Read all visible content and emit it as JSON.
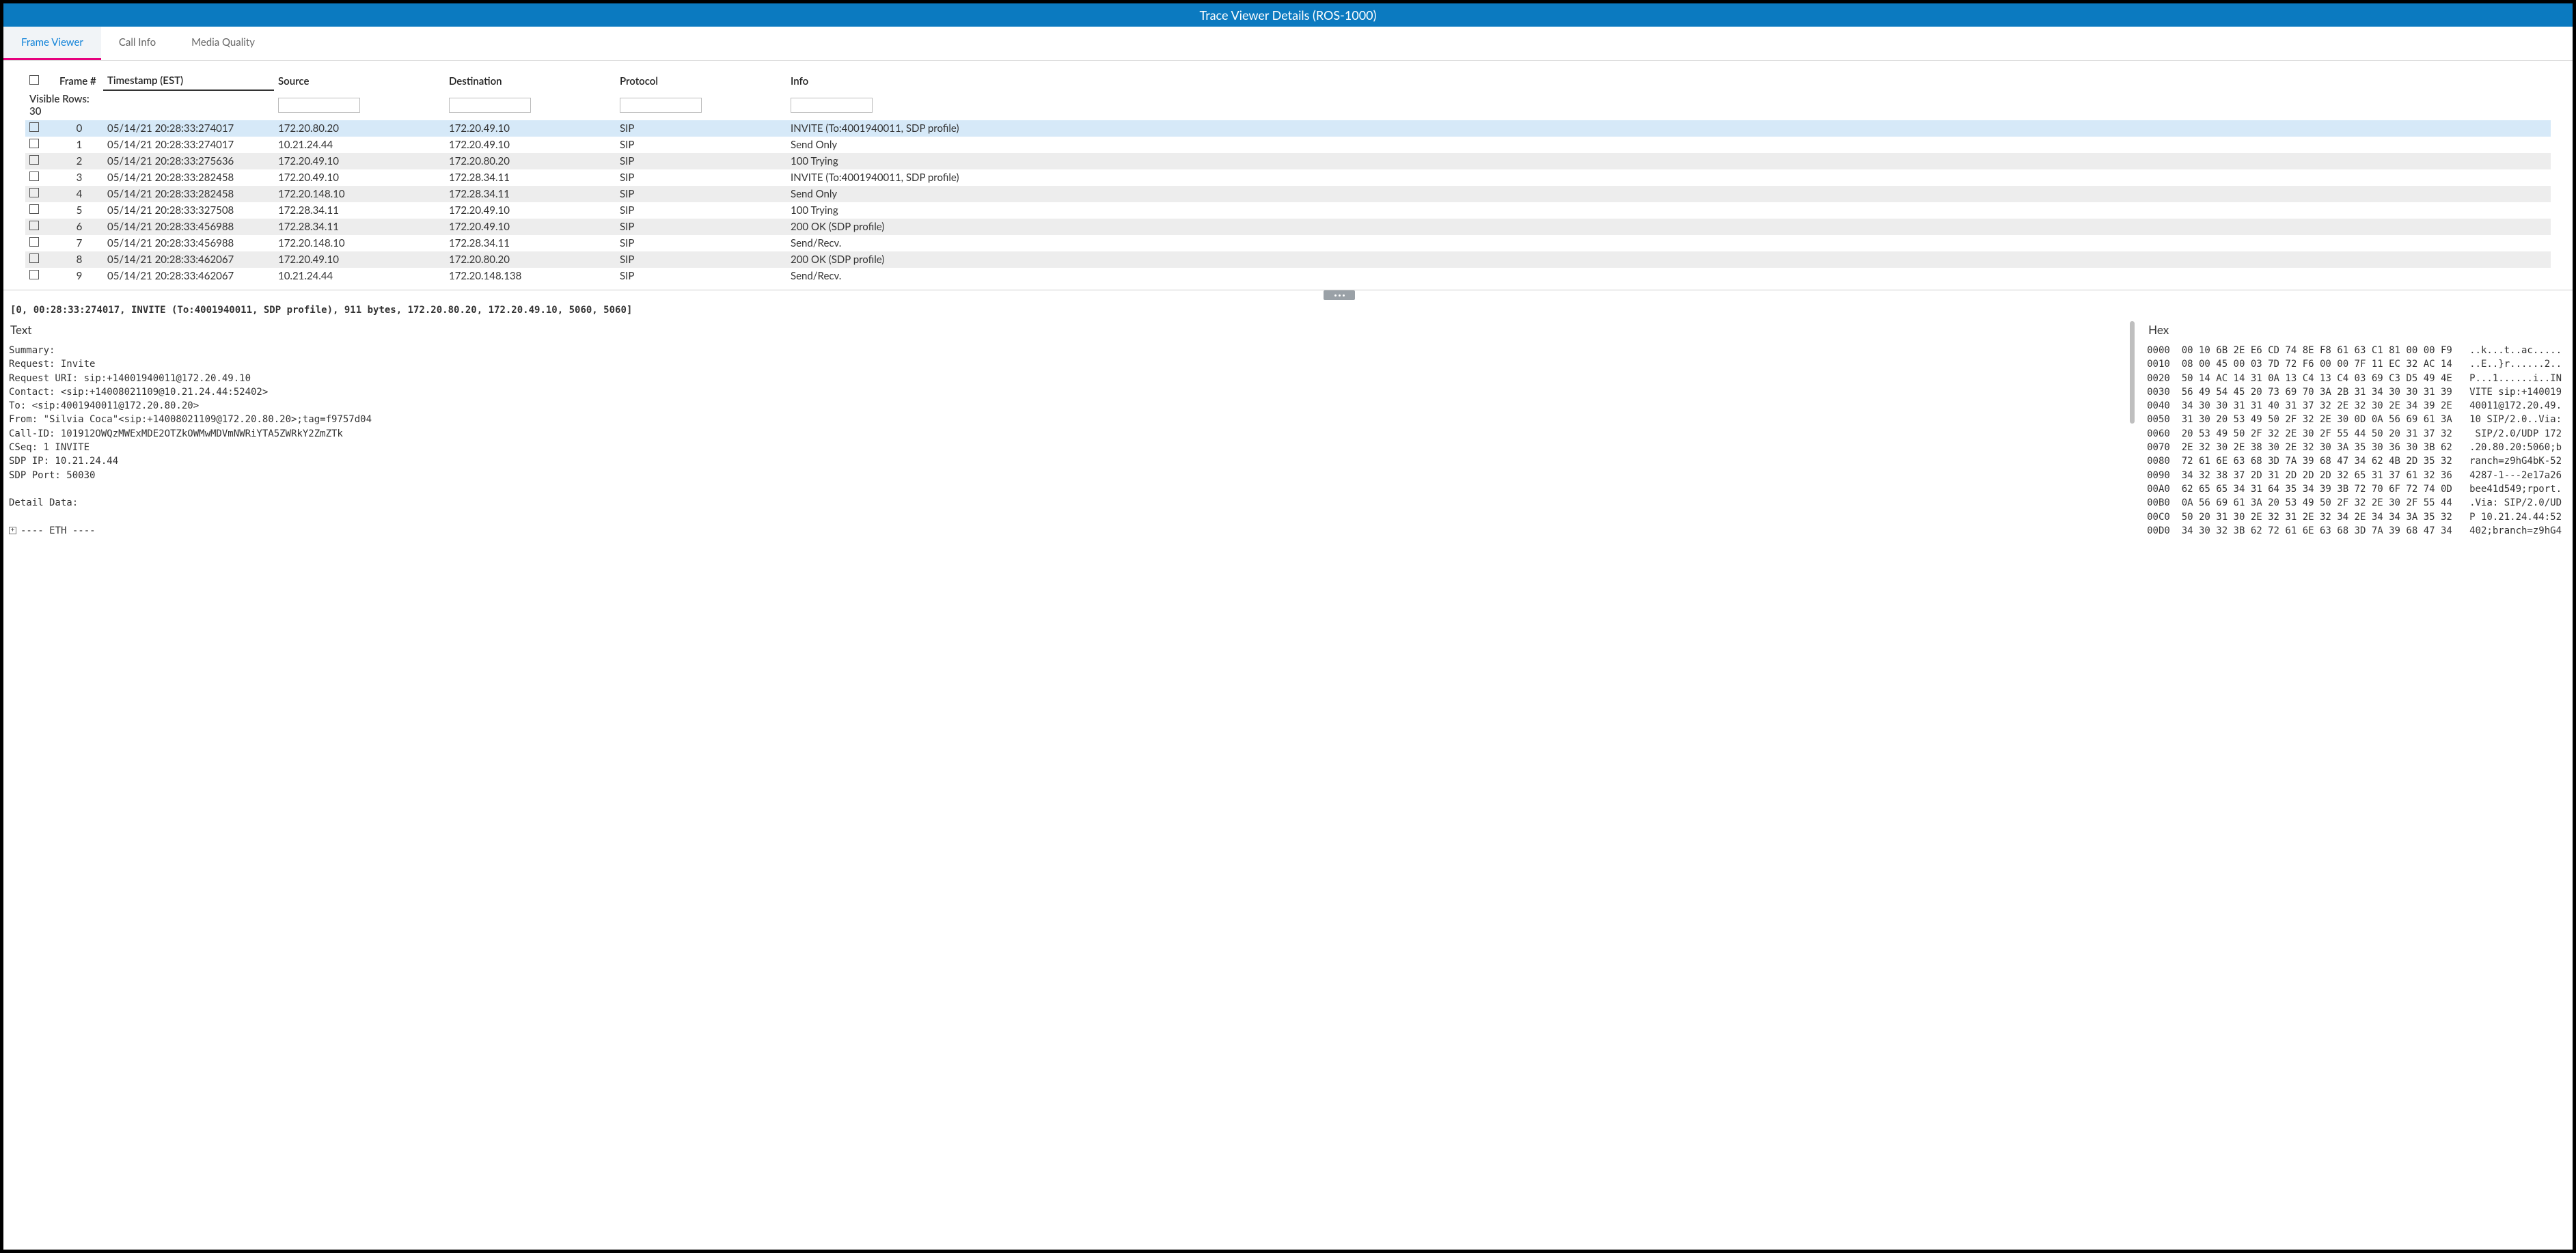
{
  "window": {
    "title": "Trace Viewer Details (ROS-1000)"
  },
  "tabs": [
    {
      "label": "Frame Viewer",
      "active": true
    },
    {
      "label": "Call Info",
      "active": false
    },
    {
      "label": "Media Quality",
      "active": false
    }
  ],
  "table": {
    "headers": {
      "frame": "Frame #",
      "timestamp": "Timestamp (EST)",
      "source": "Source",
      "destination": "Destination",
      "protocol": "Protocol",
      "info": "Info"
    },
    "visible_rows_label": "Visible Rows: 30",
    "rows": [
      {
        "n": "0",
        "ts": "05/14/21 20:28:33:274017",
        "src": "172.20.80.20",
        "dst": "172.20.49.10",
        "proto": "SIP",
        "info": "INVITE (To:4001940011, SDP profile)",
        "selected": true
      },
      {
        "n": "1",
        "ts": "05/14/21 20:28:33:274017",
        "src": "10.21.24.44",
        "dst": "172.20.49.10",
        "proto": "SIP",
        "info": "Send Only"
      },
      {
        "n": "2",
        "ts": "05/14/21 20:28:33:275636",
        "src": "172.20.49.10",
        "dst": "172.20.80.20",
        "proto": "SIP",
        "info": "100 Trying"
      },
      {
        "n": "3",
        "ts": "05/14/21 20:28:33:282458",
        "src": "172.20.49.10",
        "dst": "172.28.34.11",
        "proto": "SIP",
        "info": "INVITE (To:4001940011, SDP profile)"
      },
      {
        "n": "4",
        "ts": "05/14/21 20:28:33:282458",
        "src": "172.20.148.10",
        "dst": "172.28.34.11",
        "proto": "SIP",
        "info": "Send Only"
      },
      {
        "n": "5",
        "ts": "05/14/21 20:28:33:327508",
        "src": "172.28.34.11",
        "dst": "172.20.49.10",
        "proto": "SIP",
        "info": "100 Trying"
      },
      {
        "n": "6",
        "ts": "05/14/21 20:28:33:456988",
        "src": "172.28.34.11",
        "dst": "172.20.49.10",
        "proto": "SIP",
        "info": "200 OK (SDP profile)"
      },
      {
        "n": "7",
        "ts": "05/14/21 20:28:33:456988",
        "src": "172.20.148.10",
        "dst": "172.28.34.11",
        "proto": "SIP",
        "info": "Send/Recv."
      },
      {
        "n": "8",
        "ts": "05/14/21 20:28:33:462067",
        "src": "172.20.49.10",
        "dst": "172.20.80.20",
        "proto": "SIP",
        "info": "200 OK (SDP profile)"
      },
      {
        "n": "9",
        "ts": "05/14/21 20:28:33:462067",
        "src": "10.21.24.44",
        "dst": "172.20.148.138",
        "proto": "SIP",
        "info": "Send/Recv."
      }
    ]
  },
  "detail": {
    "summary_line": "[0, 00:28:33:274017, INVITE (To:4001940011, SDP profile), 911 bytes, 172.20.80.20, 172.20.49.10, 5060, 5060]",
    "text_heading": "Text",
    "hex_heading": "Hex",
    "text_body": "Summary:\nRequest: Invite\nRequest URI: sip:+14001940011@172.20.49.10\nContact: <sip:+14008021109@10.21.24.44:52402>\nTo: <sip:4001940011@172.20.80.20>\nFrom: \"Silvia Coca\"<sip:+14008021109@172.20.80.20>;tag=f9757d04\nCall-ID: 101912OWQzMWExMDE2OTZkOWMwMDVmNWRiYTA5ZWRkY2ZmZTk\nCSeq: 1 INVITE\nSDP IP: 10.21.24.44\nSDP Port: 50030\n\nDetail Data:",
    "tree_eth": "---- ETH ----",
    "hex_body": "0000  00 10 6B 2E E6 CD 74 8E F8 61 63 C1 81 00 00 F9   ..k...t..ac.....\n0010  08 00 45 00 03 7D 72 F6 00 00 7F 11 EC 32 AC 14   ..E..}r......2..\n0020  50 14 AC 14 31 0A 13 C4 13 C4 03 69 C3 D5 49 4E   P...1......i..IN\n0030  56 49 54 45 20 73 69 70 3A 2B 31 34 30 30 31 39   VITE sip:+140019\n0040  34 30 30 31 31 40 31 37 32 2E 32 30 2E 34 39 2E   40011@172.20.49.\n0050  31 30 20 53 49 50 2F 32 2E 30 0D 0A 56 69 61 3A   10 SIP/2.0..Via:\n0060  20 53 49 50 2F 32 2E 30 2F 55 44 50 20 31 37 32    SIP/2.0/UDP 172\n0070  2E 32 30 2E 38 30 2E 32 30 3A 35 30 36 30 3B 62   .20.80.20:5060;b\n0080  72 61 6E 63 68 3D 7A 39 68 47 34 62 4B 2D 35 32   ranch=z9hG4bK-52\n0090  34 32 38 37 2D 31 2D 2D 2D 32 65 31 37 61 32 36   4287-1---2e17a26\n00A0  62 65 65 34 31 64 35 34 39 3B 72 70 6F 72 74 0D   bee41d549;rport.\n00B0  0A 56 69 61 3A 20 53 49 50 2F 32 2E 30 2F 55 44   .Via: SIP/2.0/UD\n00C0  50 20 31 30 2E 32 31 2E 32 34 2E 34 34 3A 35 32   P 10.21.24.44:52\n00D0  34 30 32 3B 62 72 61 6E 63 68 3D 7A 39 68 47 34   402;branch=z9hG4"
  }
}
